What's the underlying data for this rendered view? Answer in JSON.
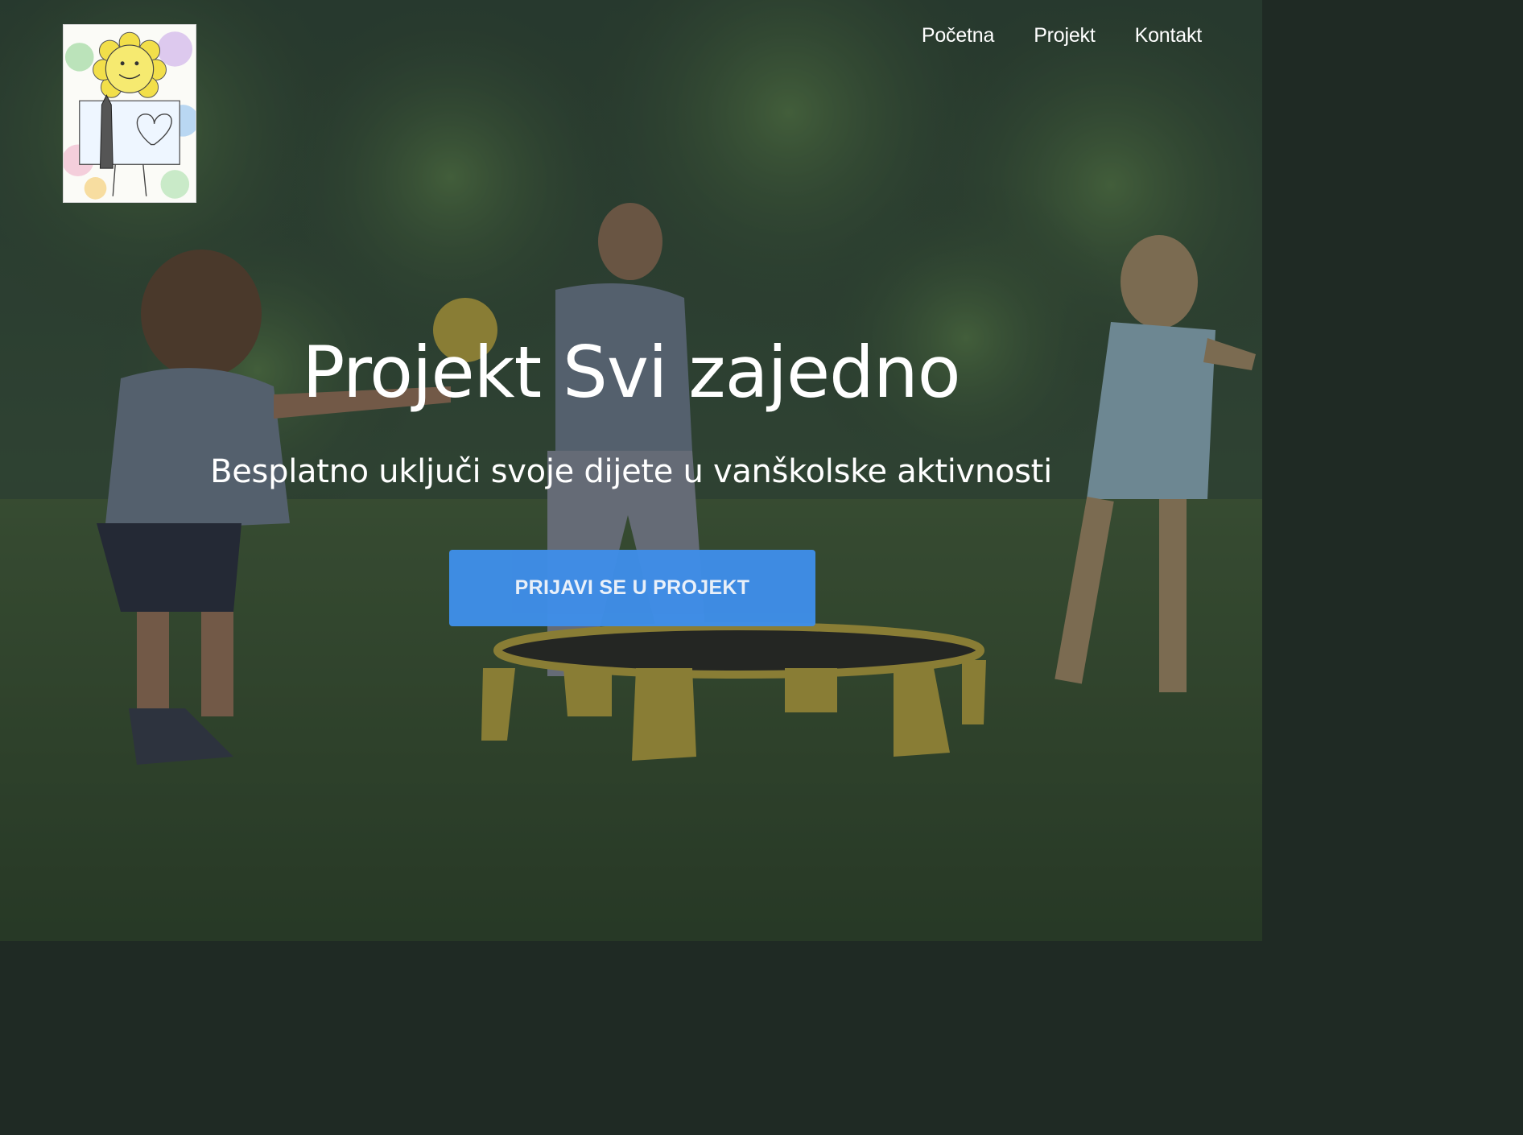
{
  "logo": {
    "icon": "child-drawing-logo-icon"
  },
  "nav": {
    "items": [
      {
        "label": "Početna"
      },
      {
        "label": "Projekt"
      },
      {
        "label": "Kontakt"
      }
    ]
  },
  "hero": {
    "title": "Projekt Svi zajedno",
    "subtitle": "Besplatno uključi svoje dijete u vanškolske aktivnosti",
    "cta_label": "PRIJAVI SE U PROJEKT",
    "background_icon": "kids-playing-spikeball-photo"
  },
  "colors": {
    "accent": "#3f8ee8",
    "text": "#ffffff",
    "overlay": "rgba(28,34,38,0.42)"
  }
}
